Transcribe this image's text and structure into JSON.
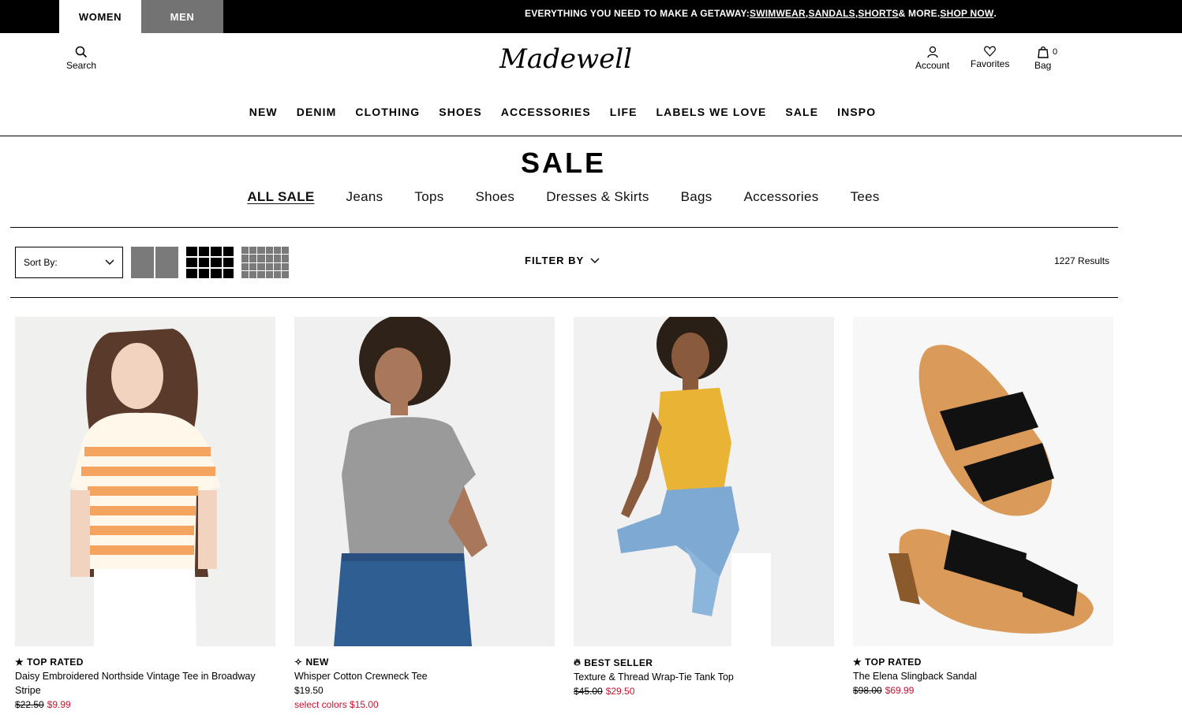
{
  "topbar": {
    "tab_women": "WOMEN",
    "tab_men": "MEN",
    "promo_prefix": "EVERYTHING YOU NEED TO MAKE A GETAWAY: ",
    "promo_link1": "SWIMWEAR",
    "promo_sep1": ", ",
    "promo_link2": "SANDALS",
    "promo_sep2": ", ",
    "promo_link3": "SHORTS",
    "promo_mid": " & MORE. ",
    "promo_cta": "SHOP NOW",
    "promo_end": "."
  },
  "header": {
    "search_label": "Search",
    "logo_text": "Madewell",
    "account_label": "Account",
    "favorites_label": "Favorites",
    "bag_label": "Bag",
    "bag_count": "0"
  },
  "nav": {
    "items": [
      "NEW",
      "DENIM",
      "CLOTHING",
      "SHOES",
      "ACCESSORIES",
      "LIFE",
      "LABELS WE LOVE",
      "SALE",
      "INSPO"
    ]
  },
  "page": {
    "title": "SALE",
    "categories": [
      "ALL SALE",
      "Jeans",
      "Tops",
      "Shoes",
      "Dresses & Skirts",
      "Bags",
      "Accessories",
      "Tees"
    ]
  },
  "toolbar": {
    "sort_label": "Sort By:",
    "filter_label": "FILTER BY",
    "results": "1227 Results"
  },
  "products": [
    {
      "badge": "TOP RATED",
      "badge_icon": "star-icon",
      "name": "Daisy Embroidered Northside Vintage Tee in Broadway Stripe",
      "price_original": "$22.50",
      "price_sale": "$9.99",
      "note": ""
    },
    {
      "badge": "NEW",
      "badge_icon": "sparkle-icon",
      "name": "Whisper Cotton Crewneck Tee",
      "price_original": "",
      "price_regular": "$19.50",
      "note": "select colors $15.00"
    },
    {
      "badge": "BEST SELLER",
      "badge_icon": "flame-icon",
      "name": "Texture & Thread Wrap-Tie Tank Top",
      "price_original": "$45.00",
      "price_sale": "$29.50",
      "note": ""
    },
    {
      "badge": "TOP RATED",
      "badge_icon": "star-icon",
      "name": "The Elena Slingback Sandal",
      "price_original": "$98.00",
      "price_sale": "$69.99",
      "note": ""
    }
  ],
  "colors": {
    "sale_red": "#c8102e",
    "men_tab_gray": "#737373",
    "image_bg": "#f2f2f2"
  }
}
